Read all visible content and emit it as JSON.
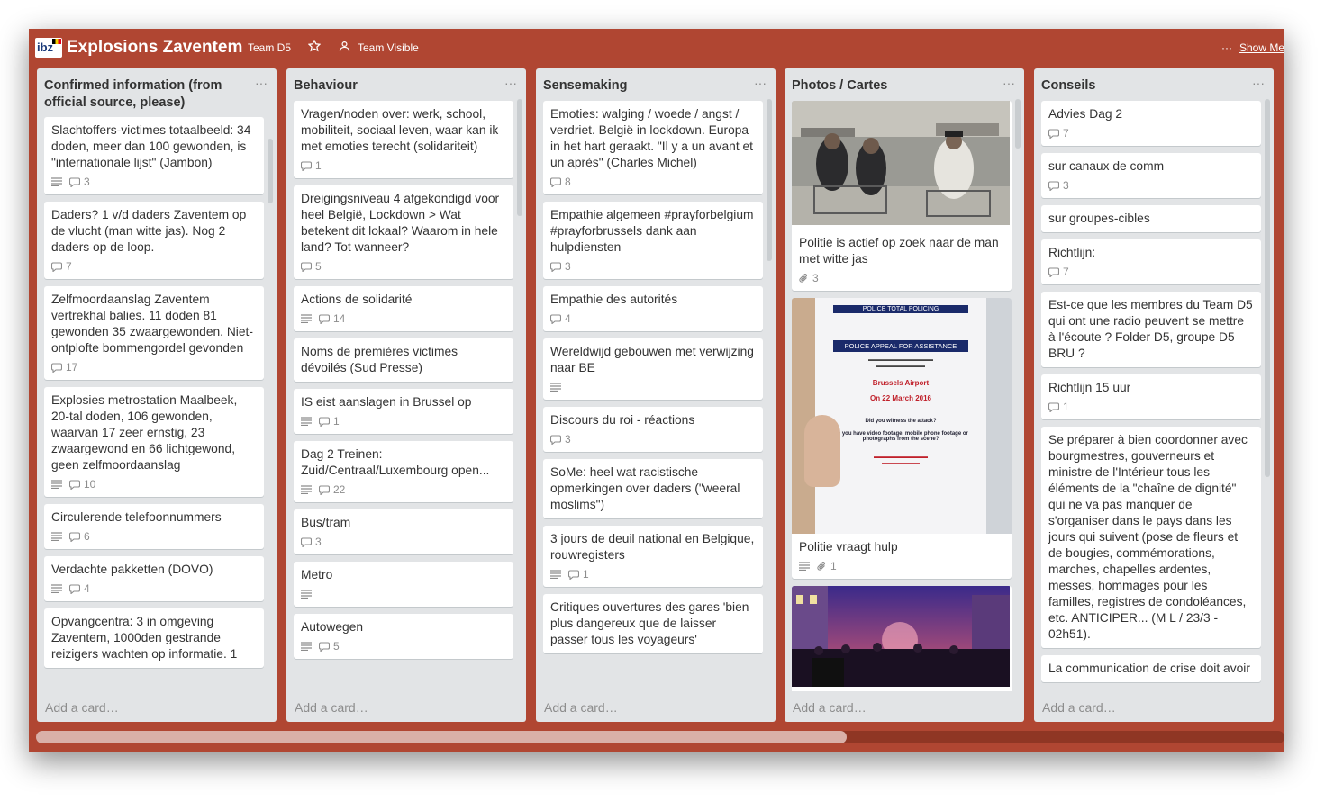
{
  "header": {
    "logo_text": "ibz",
    "board_title": "Explosions Zaventem",
    "team_label": "Team D5",
    "visibility_label": "Team Visible",
    "show_menu_label": "Show Me"
  },
  "lists": [
    {
      "title": "Confirmed information (from official source, please)",
      "add_card": "Add a card…",
      "cards": [
        {
          "title": "Slachtoffers-victimes totaalbeeld: 34 doden, meer dan 100 gewonden, is \"internationale lijst\" (Jambon)",
          "desc": true,
          "comments": "3"
        },
        {
          "title": "Daders? 1 v/d daders Zaventem op de vlucht (man witte jas). Nog 2 daders op de loop.",
          "desc": false,
          "comments": "7"
        },
        {
          "title": "Zelfmoordaanslag Zaventem vertrekhal balies. 11 doden 81 gewonden 35 zwaargewonden. Niet-ontplofte bommengordel gevonden",
          "desc": false,
          "comments": "17"
        },
        {
          "title": "Explosies metrostation Maalbeek, 20-tal doden, 106 gewonden, waarvan 17 zeer ernstig, 23 zwaargewond en 66 lichtgewond, geen zelfmoordaanslag",
          "desc": true,
          "comments": "10"
        },
        {
          "title": "Circulerende telefoonnummers",
          "desc": true,
          "comments": "6"
        },
        {
          "title": "Verdachte pakketten (DOVO)",
          "desc": true,
          "comments": "4"
        },
        {
          "title": "Opvangcentra: 3 in omgeving Zaventem, 1000den gestrande reizigers wachten op informatie. 1",
          "desc": false,
          "comments": ""
        }
      ]
    },
    {
      "title": "Behaviour",
      "add_card": "Add a card…",
      "cards": [
        {
          "title": "Vragen/noden over: werk, school, mobiliteit, sociaal leven, waar kan ik met emoties terecht (solidariteit)",
          "desc": false,
          "comments": "1"
        },
        {
          "title": "Dreigingsniveau 4 afgekondigd voor heel België, Lockdown > Wat betekent dit lokaal? Waarom in hele land? Tot wanneer?",
          "desc": false,
          "comments": "5"
        },
        {
          "title": "Actions de solidarité",
          "desc": true,
          "comments": "14"
        },
        {
          "title": "Noms de premières victimes dévoilés (Sud Presse)",
          "desc": false,
          "comments": ""
        },
        {
          "title": "IS eist aanslagen in Brussel op",
          "desc": true,
          "comments": "1"
        },
        {
          "title": "Dag 2 Treinen: Zuid/Centraal/Luxembourg open...",
          "desc": true,
          "comments": "22"
        },
        {
          "title": "Bus/tram",
          "desc": false,
          "comments": "3"
        },
        {
          "title": "Metro",
          "desc": true,
          "comments": ""
        },
        {
          "title": "Autowegen",
          "desc": true,
          "comments": "5"
        }
      ]
    },
    {
      "title": "Sensemaking",
      "add_card": "Add a card…",
      "cards": [
        {
          "title": "Emoties: walging / woede / angst / verdriet. België in lockdown. Europa in het hart geraakt. \"Il y a un avant et un après\" (Charles Michel)",
          "desc": false,
          "comments": "8"
        },
        {
          "title": "Empathie algemeen #prayforbelgium #prayforbrussels dank aan hulpdiensten",
          "desc": false,
          "comments": "3"
        },
        {
          "title": "Empathie des autorités",
          "desc": false,
          "comments": "4"
        },
        {
          "title": "Wereldwijd gebouwen met verwijzing naar BE",
          "desc": true,
          "comments": ""
        },
        {
          "title": "Discours du roi - réactions",
          "desc": false,
          "comments": "3"
        },
        {
          "title": "SoMe: heel wat racistische opmerkingen over daders (\"weeral moslims\")",
          "desc": false,
          "comments": ""
        },
        {
          "title": "3 jours de deuil national en Belgique, rouwregisters",
          "desc": true,
          "comments": "1"
        },
        {
          "title": "Critiques ouvertures des gares 'bien plus dangereux que de laisser passer tous les voyageurs'",
          "desc": false,
          "comments": ""
        }
      ]
    },
    {
      "title": "Photos / Cartes",
      "add_card": "Add a card…",
      "cards": [
        {
          "title": "Politie is actief op zoek naar de man met witte jas",
          "attachments": "3",
          "photo": "airport-cctv"
        },
        {
          "title": "Politie vraagt hulp",
          "desc": true,
          "attachments": "1",
          "photo": "police-appeal",
          "flyer": {
            "police": "POLICE",
            "total": "TOTAL POLICING",
            "appeal": "POLICE APPEAL FOR ASSISTANCE",
            "airport": "Brussels Airport",
            "date": "On 22 March 2016",
            "witness": "Did you witness the attack?",
            "footage": "Do you have video footage, mobile phone footage or photographs from the scene?"
          }
        },
        {
          "title": "",
          "photo": "crowd-night"
        }
      ]
    },
    {
      "title": "Conseils",
      "add_card": "Add a card…",
      "cards": [
        {
          "title": "Advies Dag 2",
          "desc": false,
          "comments": "7"
        },
        {
          "title": "sur canaux de comm",
          "desc": false,
          "comments": "3"
        },
        {
          "title": "sur groupes-cibles",
          "desc": false,
          "comments": ""
        },
        {
          "title": "Richtlijn:",
          "desc": false,
          "comments": "7"
        },
        {
          "title": "Est-ce que les membres du Team D5 qui ont une radio peuvent se mettre à l'écoute ? Folder D5, groupe D5 BRU ?",
          "desc": false,
          "comments": ""
        },
        {
          "title": "Richtlijn 15 uur",
          "desc": false,
          "comments": "1"
        },
        {
          "title": "Se préparer à bien coordonner avec bourgmestres, gouverneurs et ministre de l'Intérieur tous les éléments de la \"chaîne de dignité\" qui ne va pas manquer de s'organiser dans le pays dans les jours qui suivent (pose de fleurs et de bougies, commémorations, marches, chapelles ardentes, messes, hommages pour les familles, registres de condoléances, etc. ANTICIPER... (M L / 23/3 - 02h51).",
          "desc": false,
          "comments": ""
        },
        {
          "title": "La communication de crise doit avoir",
          "desc": false,
          "comments": ""
        }
      ]
    }
  ]
}
